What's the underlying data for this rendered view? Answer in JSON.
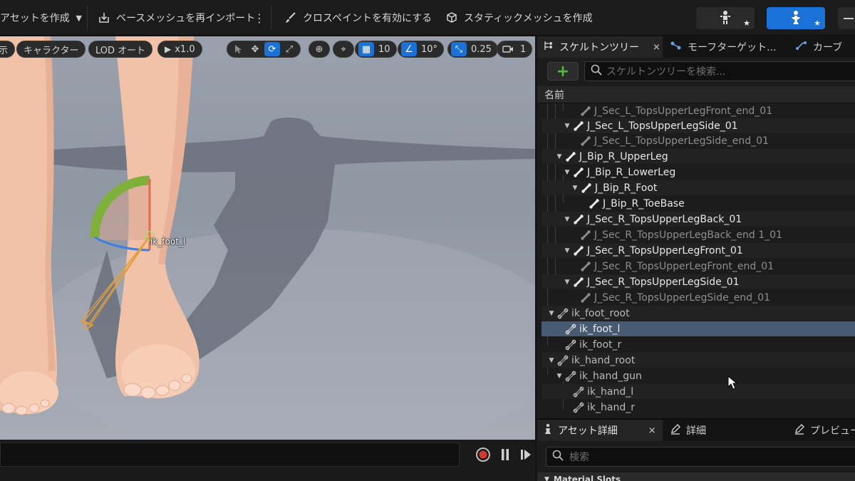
{
  "toolbar": {
    "create_asset": "アセットを作成",
    "reimport_mesh": "ベースメッシュを再インポート",
    "cloth_paint": "クロスペイントを有効にする",
    "static_mesh": "スタティックメッシュを作成",
    "mode_star": "★"
  },
  "viewport": {
    "pill_partial": "示",
    "pill_character": "キャラクター",
    "pill_lod": "LOD オート",
    "pill_play": "x1.0",
    "grid_snap": "10",
    "angle_snap": "10°",
    "scale_snap": "0.25",
    "camera_speed": "1",
    "bone_label": "ik_foot_l"
  },
  "skeleton_panel": {
    "tabs": [
      {
        "label": "スケルトンツリー",
        "close": "×"
      },
      {
        "label": "モーフターゲット..."
      },
      {
        "label": "カーブ"
      }
    ],
    "add_label": "+",
    "search_placeholder": "スケルトンツリーを検索...",
    "column_header": "名前",
    "rows": [
      {
        "label": "J_Sec_L_TopsUpperLegFront_end_01"
      },
      {
        "label": "J_Sec_L_TopsUpperLegSide_01"
      },
      {
        "label": "J_Sec_L_TopsUpperLegSide_end_01"
      },
      {
        "label": "J_Bip_R_UpperLeg"
      },
      {
        "label": "J_Bip_R_LowerLeg"
      },
      {
        "label": "J_Bip_R_Foot"
      },
      {
        "label": "J_Bip_R_ToeBase"
      },
      {
        "label": "J_Sec_R_TopsUpperLegBack_01"
      },
      {
        "label": "J_Sec_R_TopsUpperLegBack_end 1_01"
      },
      {
        "label": "J_Sec_R_TopsUpperLegFront_01"
      },
      {
        "label": "J_Sec_R_TopsUpperLegFront_end_01"
      },
      {
        "label": "J_Sec_R_TopsUpperLegSide_01"
      },
      {
        "label": "J_Sec_R_TopsUpperLegSide_end_01"
      },
      {
        "label": "ik_foot_root"
      },
      {
        "label": "ik_foot_l"
      },
      {
        "label": "ik_foot_r"
      },
      {
        "label": "ik_hand_root"
      },
      {
        "label": "ik_hand_gun"
      },
      {
        "label": "ik_hand_l"
      },
      {
        "label": "ik_hand_r"
      }
    ]
  },
  "details_panel": {
    "tabs": [
      {
        "label": "アセット詳細",
        "close": "×"
      },
      {
        "label": "詳細"
      },
      {
        "label": "プレビュー"
      }
    ],
    "search_placeholder": "検索",
    "section": "Material Slots"
  },
  "colors": {
    "accent": "#1a72d8",
    "selection": "#465a72",
    "add_green": "#4fbf3a"
  }
}
